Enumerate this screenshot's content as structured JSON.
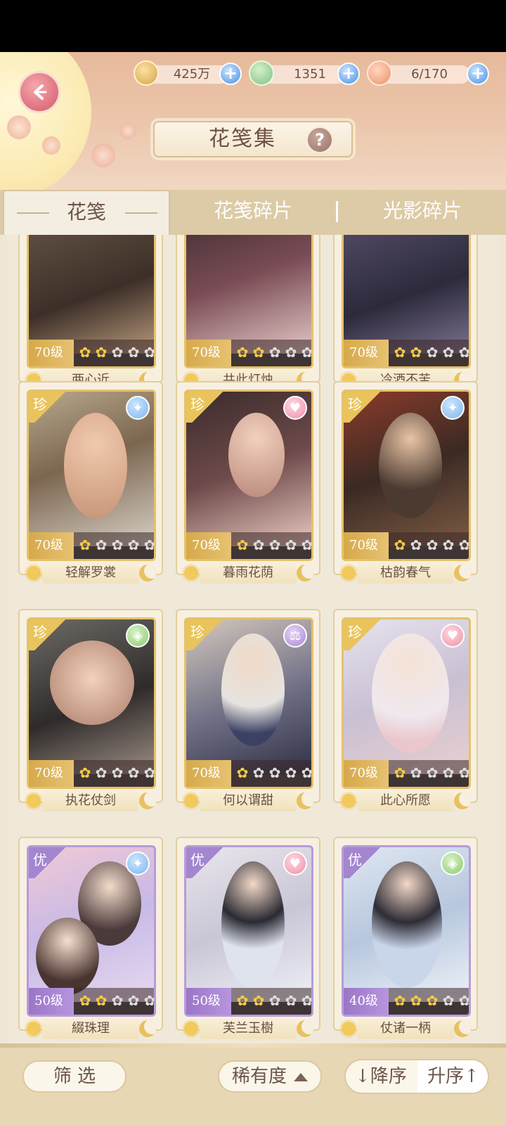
{
  "header": {
    "title": "花笺集",
    "help_label": "?",
    "resources": [
      {
        "icon": "paw-coin-icon",
        "value": "425万"
      },
      {
        "icon": "jade-icon",
        "value": "1351"
      },
      {
        "icon": "bun-stamina-icon",
        "value": "6/170"
      }
    ],
    "plus_label": "+"
  },
  "tabs": [
    {
      "label": "花笺"
    },
    {
      "label": "花笺碎片"
    },
    {
      "label": "光影碎片"
    }
  ],
  "cards": [
    {
      "level": "70级",
      "stars": 2,
      "name": "两心近",
      "rarity": "",
      "badge": ""
    },
    {
      "level": "70级",
      "stars": 2,
      "name": "共此灯烛",
      "rarity": "",
      "badge": ""
    },
    {
      "level": "70级",
      "stars": 2,
      "name": "冷酒不苦",
      "rarity": "",
      "badge": ""
    },
    {
      "level": "70级",
      "stars": 1,
      "name": "轻解罗裳",
      "rarity": "珍",
      "badge": "blue"
    },
    {
      "level": "70级",
      "stars": 1,
      "name": "暮雨花荫",
      "rarity": "珍",
      "badge": "pink"
    },
    {
      "level": "70级",
      "stars": 1,
      "name": "枯韵春气",
      "rarity": "珍",
      "badge": "blue"
    },
    {
      "level": "70级",
      "stars": 1,
      "name": "执花仗剑",
      "rarity": "珍",
      "badge": "green"
    },
    {
      "level": "70级",
      "stars": 1,
      "name": "何以谓甜",
      "rarity": "珍",
      "badge": "violet"
    },
    {
      "level": "70级",
      "stars": 1,
      "name": "此心所愿",
      "rarity": "珍",
      "badge": "pink"
    },
    {
      "level": "50级",
      "stars": 2,
      "name": "綴珠理",
      "rarity": "优",
      "badge": "blue"
    },
    {
      "level": "50级",
      "stars": 2,
      "name": "芙兰玉樹",
      "rarity": "优",
      "badge": "pink"
    },
    {
      "level": "40级",
      "stars": 3,
      "name": "仗诸一柄",
      "rarity": "优",
      "badge": "green"
    }
  ],
  "footer": {
    "filter_label": "筛 选",
    "rarity_label": "稀有度",
    "desc_label": "↓降序",
    "asc_label": "升序↑"
  },
  "colors": {
    "gold_frame": "#e5c26a",
    "purple_frame": "#b99bd9",
    "accent_blue": "#7bb2ee",
    "back_pink": "#e27884"
  }
}
